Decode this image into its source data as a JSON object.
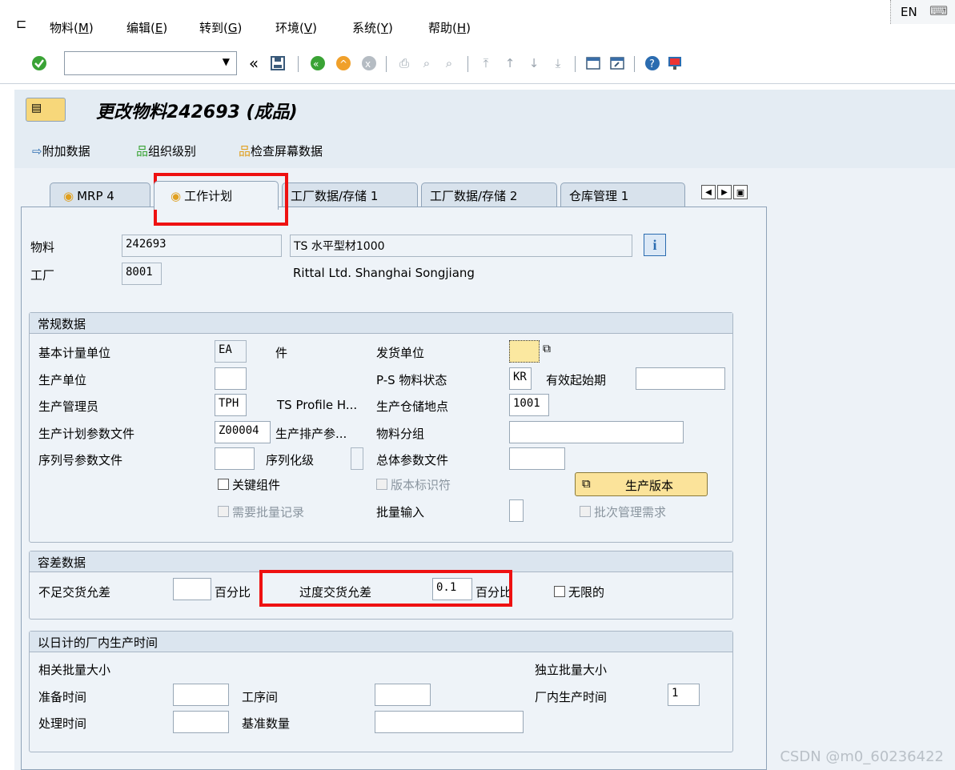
{
  "menu": {
    "items": [
      {
        "label": "物料(",
        "key": "M",
        "suffix": ")"
      },
      {
        "label": "编辑(",
        "key": "E",
        "suffix": ")"
      },
      {
        "label": "转到(",
        "key": "G",
        "suffix": ")"
      },
      {
        "label": "环境(",
        "key": "V",
        "suffix": ")"
      },
      {
        "label": "系统(",
        "key": "Y",
        "suffix": ")"
      },
      {
        "label": "帮助(",
        "key": "H",
        "suffix": ")"
      }
    ],
    "lang": "EN"
  },
  "toolbar": {
    "command_field": "",
    "back_glyph": "«",
    "dropdown_glyph": "▼"
  },
  "title": "更改物料242693 (成品)",
  "app_toolbar": {
    "additional_data": "附加数据",
    "org_levels": "组织级别",
    "check_screen": "检查屏幕数据"
  },
  "tabs": [
    {
      "label": "MRP 4",
      "active": false
    },
    {
      "label": "工作计划",
      "active": true
    },
    {
      "label": "工厂数据/存储 1",
      "active": false
    },
    {
      "label": "工厂数据/存储 2",
      "active": false
    },
    {
      "label": "仓库管理 1",
      "active": false
    }
  ],
  "header": {
    "material_label": "物料",
    "material_value": "242693",
    "material_desc": "TS 水平型材1000",
    "plant_label": "工厂",
    "plant_value": "8001",
    "plant_desc": "Rittal Ltd. Shanghai Songjiang"
  },
  "general": {
    "title": "常规数据",
    "base_uom_label": "基本计量单位",
    "base_uom_value": "EA",
    "base_uom_text": "件",
    "unit_of_issue_label": "发货单位",
    "unit_of_issue_value": "",
    "prod_unit_label": "生产单位",
    "prod_unit_value": "",
    "ps_status_label": "P-S 物料状态",
    "ps_status_value": "KR",
    "valid_from_label": "有效起始期",
    "valid_from_value": "",
    "supervisor_label": "生产管理员",
    "supervisor_value": "TPH",
    "supervisor_text": "TS Profile H...",
    "storage_loc_label": "生产仓储地点",
    "storage_loc_value": "1001",
    "sched_profile_label": "生产计划参数文件",
    "sched_profile_value": "Z00004",
    "sched_profile_text": "生产排产参...",
    "material_group_label": "物料分组",
    "material_group_value": "",
    "serial_profile_label": "序列号参数文件",
    "serial_profile_value": "",
    "serial_level_label": "序列化级",
    "overall_profile_label": "总体参数文件",
    "overall_profile_value": "",
    "critical_part_label": "关键组件",
    "version_indicator_label": "版本标识符",
    "prod_version_button": "生产版本",
    "batch_record_label": "需要批量记录",
    "batch_entry_label": "批量输入",
    "batch_mgmt_label": "批次管理需求"
  },
  "tolerance": {
    "title": "容差数据",
    "under_label": "不足交货允差",
    "under_value": "",
    "under_unit": "百分比",
    "over_label": "过度交货允差",
    "over_value": "0.1",
    "over_unit": "百分比",
    "unlimited_label": "无限的"
  },
  "inhouse": {
    "title": "以日计的厂内生产时间",
    "lot_dependent": "相关批量大小",
    "lot_independent": "独立批量大小",
    "setup_label": "准备时间",
    "setup_value": "",
    "interop_label": "工序间",
    "interop_value": "",
    "inhouse_label": "厂内生产时间",
    "inhouse_value": "1",
    "processing_label": "处理时间",
    "processing_value": "",
    "base_qty_label": "基准数量",
    "base_qty_value": ""
  },
  "watermark": "CSDN @m0_60236422",
  "colors": {
    "highlight": "#ee1111",
    "accent": "#2b6cb0"
  }
}
